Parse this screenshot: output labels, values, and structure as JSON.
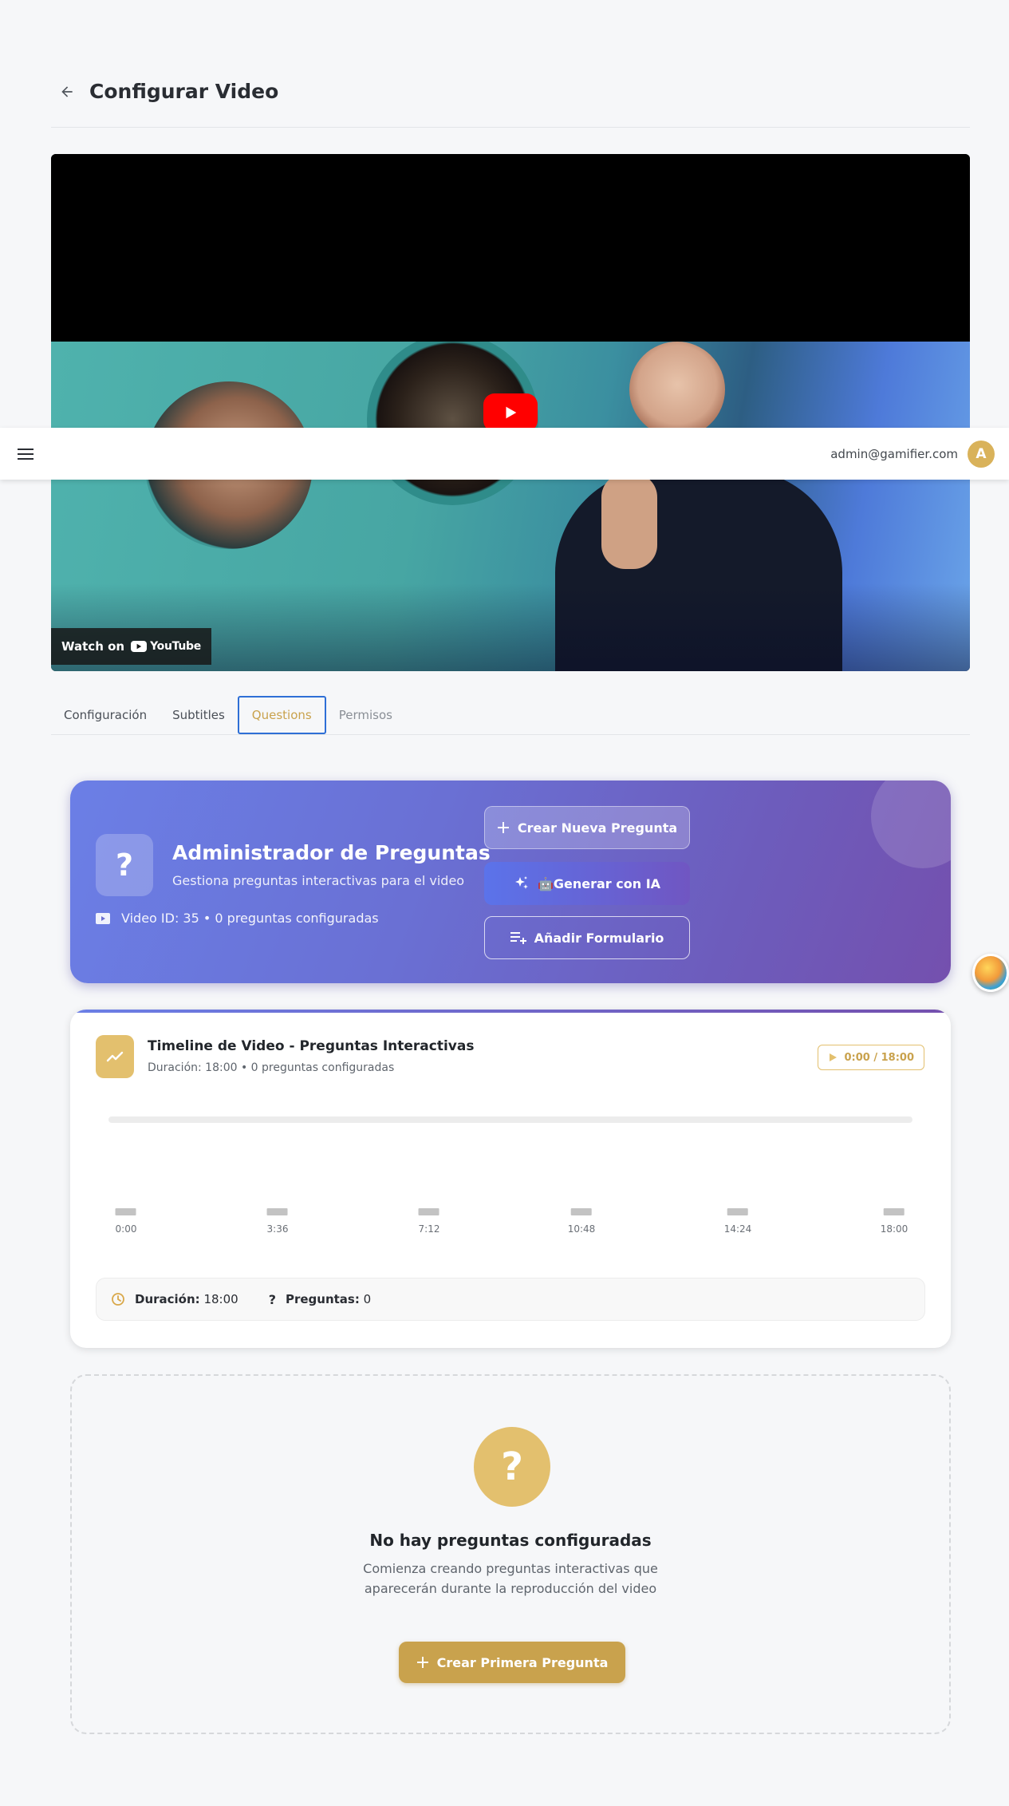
{
  "page": {
    "title": "Configurar Video"
  },
  "appbar": {
    "user_email": "admin@gamifier.com",
    "avatar_initial": "A"
  },
  "video": {
    "watch_on_label": "Watch on",
    "youtube_label": "YouTube"
  },
  "tabs": [
    {
      "label": "Configuración"
    },
    {
      "label": "Subtitles"
    },
    {
      "label": "Questions"
    },
    {
      "label": "Permisos"
    }
  ],
  "question_manager": {
    "icon_glyph": "?",
    "title": "Administrador de Preguntas",
    "subtitle": "Gestiona preguntas interactivas para el video",
    "meta": "Video ID: 35 • 0 preguntas configuradas",
    "create_button": "Crear Nueva Pregunta",
    "ai_button": "🤖Generar con IA",
    "form_button": "Añadir Formulario"
  },
  "timeline": {
    "title": "Timeline de Video - Preguntas Interactivas",
    "subtitle": "Duración: 18:00 • 0 preguntas configuradas",
    "time_display": "0:00 / 18:00",
    "ticks": [
      "0:00",
      "3:36",
      "7:12",
      "10:48",
      "14:24",
      "18:00"
    ],
    "footer": {
      "duration_label": "Duración:",
      "duration_value": "18:00",
      "questions_label": "Preguntas:",
      "questions_value": "0"
    }
  },
  "empty_state": {
    "icon_glyph": "?",
    "title": "No hay preguntas configuradas",
    "description_line1": "Comienza creando preguntas interactivas que",
    "description_line2": "aparecerán durante la reproducción del video",
    "button": "Crear Primera Pregunta"
  },
  "colors": {
    "accent_gold": "#c9a24d",
    "gradient_start": "#6b7fe6",
    "gradient_end": "#7450ae",
    "active_tab_outline": "#2e6fd6"
  }
}
